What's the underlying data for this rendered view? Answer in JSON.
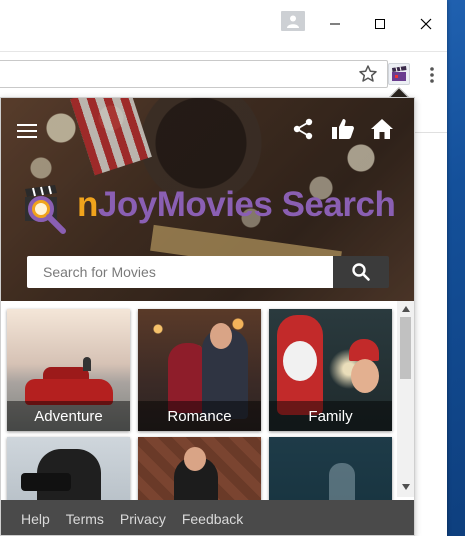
{
  "popup": {
    "logo_first": "n",
    "logo_rest": "JoyMovies Search",
    "search_placeholder": "Search for Movies"
  },
  "icons": {
    "menu": "hamburger-menu-icon",
    "share": "share-icon",
    "like": "thumbs-up-icon",
    "home": "home-icon",
    "search": "search-icon",
    "extension": "clapperboard-icon",
    "bookmark": "star-icon"
  },
  "categories": [
    {
      "label": "Adventure"
    },
    {
      "label": "Romance"
    },
    {
      "label": "Family"
    },
    {
      "label": ""
    },
    {
      "label": ""
    },
    {
      "label": ""
    }
  ],
  "footer": {
    "links": [
      "Help",
      "Terms",
      "Privacy",
      "Feedback"
    ]
  },
  "colors": {
    "logo_orange": "#f0a31c",
    "logo_purple": "#8a5fb3",
    "footer_bg": "#4a4a4a",
    "search_button_bg": "#3b3b3b"
  }
}
